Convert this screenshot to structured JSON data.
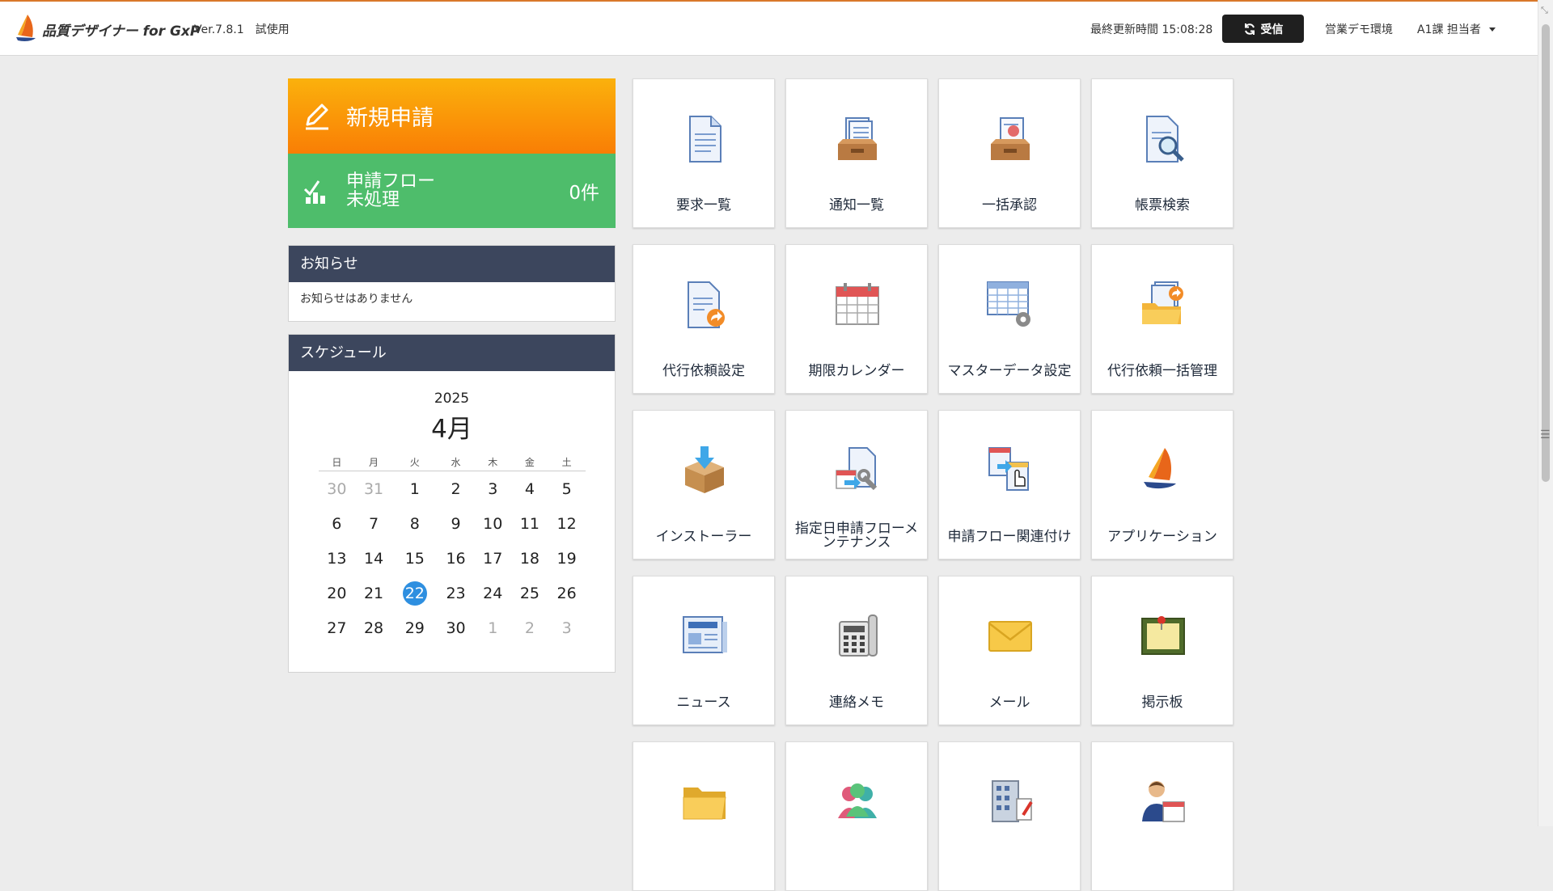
{
  "header": {
    "app_name": "品質デザイナー for GxP",
    "version": "Ver.7.8.1　試使用",
    "last_updated": "最終更新時間 15:08:28",
    "receive_label": "受信",
    "environment": "営業デモ環境",
    "user": "A1課 担当者"
  },
  "new_application": {
    "label": "新規申請",
    "icon": "pen-icon"
  },
  "pending_flow": {
    "label_line1": "申請フロー",
    "label_line2": "未処理",
    "count": "0件",
    "icon": "chart-check-icon"
  },
  "notice": {
    "title": "お知らせ",
    "message": "お知らせはありません"
  },
  "schedule": {
    "title": "スケジュール",
    "year": "2025",
    "month": "4月",
    "weekdays": [
      "日",
      "月",
      "火",
      "水",
      "木",
      "金",
      "土"
    ],
    "weeks": [
      [
        "30",
        "31",
        "1",
        "2",
        "3",
        "4",
        "5"
      ],
      [
        "6",
        "7",
        "8",
        "9",
        "10",
        "11",
        "12"
      ],
      [
        "13",
        "14",
        "15",
        "16",
        "17",
        "18",
        "19"
      ],
      [
        "20",
        "21",
        "22",
        "23",
        "24",
        "25",
        "26"
      ],
      [
        "27",
        "28",
        "29",
        "30",
        "1",
        "2",
        "3"
      ]
    ],
    "today": "22"
  },
  "tiles": [
    {
      "label": "要求一覧",
      "icon": "document-icon"
    },
    {
      "label": "通知一覧",
      "icon": "inbox-tray-icon"
    },
    {
      "label": "一括承認",
      "icon": "approval-tray-icon"
    },
    {
      "label": "帳票検索",
      "icon": "document-search-icon"
    },
    {
      "label": "代行依頼設定",
      "icon": "document-forward-icon"
    },
    {
      "label": "期限カレンダー",
      "icon": "calendar-icon"
    },
    {
      "label": "マスターデータ設定",
      "icon": "table-gear-icon"
    },
    {
      "label": "代行依頼一括管理",
      "icon": "folder-forward-icon"
    },
    {
      "label": "インストーラー",
      "icon": "box-download-icon"
    },
    {
      "label": "指定日申請フローメンテナンス",
      "icon": "document-wrench-icon"
    },
    {
      "label": "申請フロー関連付け",
      "icon": "documents-link-icon"
    },
    {
      "label": "アプリケーション",
      "icon": "sail-logo-icon"
    },
    {
      "label": "ニュース",
      "icon": "newspaper-icon"
    },
    {
      "label": "連絡メモ",
      "icon": "phone-icon"
    },
    {
      "label": "メール",
      "icon": "envelope-icon"
    },
    {
      "label": "掲示板",
      "icon": "bulletin-board-icon"
    },
    {
      "label": "",
      "icon": "folder-icon"
    },
    {
      "label": "",
      "icon": "people-icon"
    },
    {
      "label": "",
      "icon": "building-icon"
    },
    {
      "label": "",
      "icon": "person-calendar-icon"
    }
  ]
}
